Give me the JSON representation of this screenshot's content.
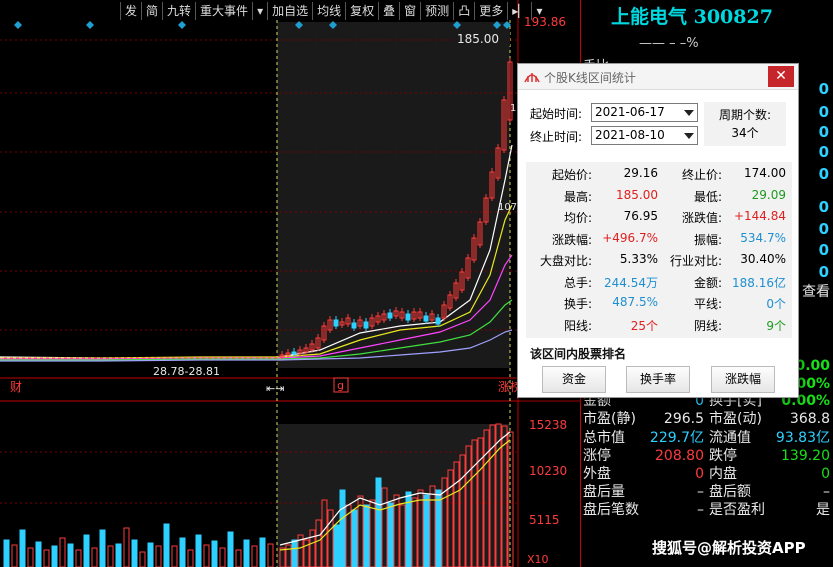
{
  "toolbar": {
    "items": [
      "发",
      "简",
      "九转",
      "重大事件",
      "▾",
      "加自选",
      "均线",
      "复权",
      "叠",
      "窗",
      "预测",
      "凸",
      "更多",
      "▸▏",
      "▾"
    ]
  },
  "main_chart": {
    "price_max_label": "193.86",
    "high_label": "185.00",
    "side_value_1": "1",
    "side_value_2": "107",
    "range_label": "28.78-28.81",
    "bottom_left_label": "财",
    "bottom_arrows": "⇤⇥",
    "bottom_marker": "g",
    "bottom_right_label": "涨榜"
  },
  "volume_chart": {
    "labels": [
      "15238",
      "10230",
      "5115",
      "X10"
    ]
  },
  "stock": {
    "title": "上能电气 300827",
    "subtitle": "—— – –%"
  },
  "right_panel": {
    "partial_label": "手比",
    "blue_digits": [
      "0",
      "0",
      "0",
      "0",
      "0",
      "0",
      "0",
      "0",
      "0",
      "0"
    ],
    "lookup": "查看",
    "val_a": "0.00",
    "val_b": "0.00%",
    "rows": [
      {
        "l1": "金额",
        "v1": "0",
        "l2": "换手[实]",
        "v2": "0.00%"
      },
      {
        "l1": "市盈(静)",
        "v1": "296.5",
        "l2": "市盈(动)",
        "v2": "368.8"
      },
      {
        "l1": "总市值",
        "v1": "229.7亿",
        "l2": "流通值",
        "v2": "93.83亿"
      },
      {
        "l1": "涨停",
        "v1": "208.80",
        "l2": "跌停",
        "v2": "139.20"
      },
      {
        "l1": "外盘",
        "v1": "0",
        "l2": "内盘",
        "v2": "0"
      },
      {
        "l1": "盘后量",
        "v1": "–",
        "l2": "盘后额",
        "v2": "–"
      },
      {
        "l1": "盘后笔数",
        "v1": "–",
        "l2": "是否盈利",
        "v2": "是"
      }
    ]
  },
  "dialog": {
    "title": "个股K线区间统计",
    "start_label": "起始时间:",
    "start_value": "2021-06-17",
    "end_label": "终止时间:",
    "end_value": "2021-08-10",
    "period_label": "周期个数:",
    "period_value": "34个",
    "stats": [
      {
        "l1": "起始价:",
        "v1": "29.16",
        "l2": "终止价:",
        "v2": "174.00"
      },
      {
        "l1": "最高:",
        "v1": "185.00",
        "l2": "最低:",
        "v2": "29.09"
      },
      {
        "l1": "均价:",
        "v1": "76.95",
        "l2": "涨跌值:",
        "v2": "+144.84"
      },
      {
        "l1": "涨跌幅:",
        "v1": "+496.7%",
        "l2": "振幅:",
        "v2": "534.7%"
      },
      {
        "l1": "大盘对比:",
        "v1": "5.33%",
        "l2": "行业对比:",
        "v2": "30.40%"
      },
      {
        "l1": "总手:",
        "v1": "244.54万",
        "l2": "金额:",
        "v2": "188.16亿"
      },
      {
        "l1": "换手:",
        "v1": "487.5%",
        "l2": "平线:",
        "v2": "0个"
      },
      {
        "l1": "阳线:",
        "v1": "25个",
        "l2": "阴线:",
        "v2": "9个"
      }
    ],
    "section_title": "该区间内股票排名",
    "buttons": [
      "资金",
      "换手率",
      "涨跌幅"
    ],
    "close": "✕"
  },
  "watermark": "搜狐号@解析投资APP",
  "colors": {
    "up": "#ff3b3b",
    "down": "#2ed0ff",
    "border": "#c00000",
    "highlight_bg": "#1c1c1c"
  }
}
